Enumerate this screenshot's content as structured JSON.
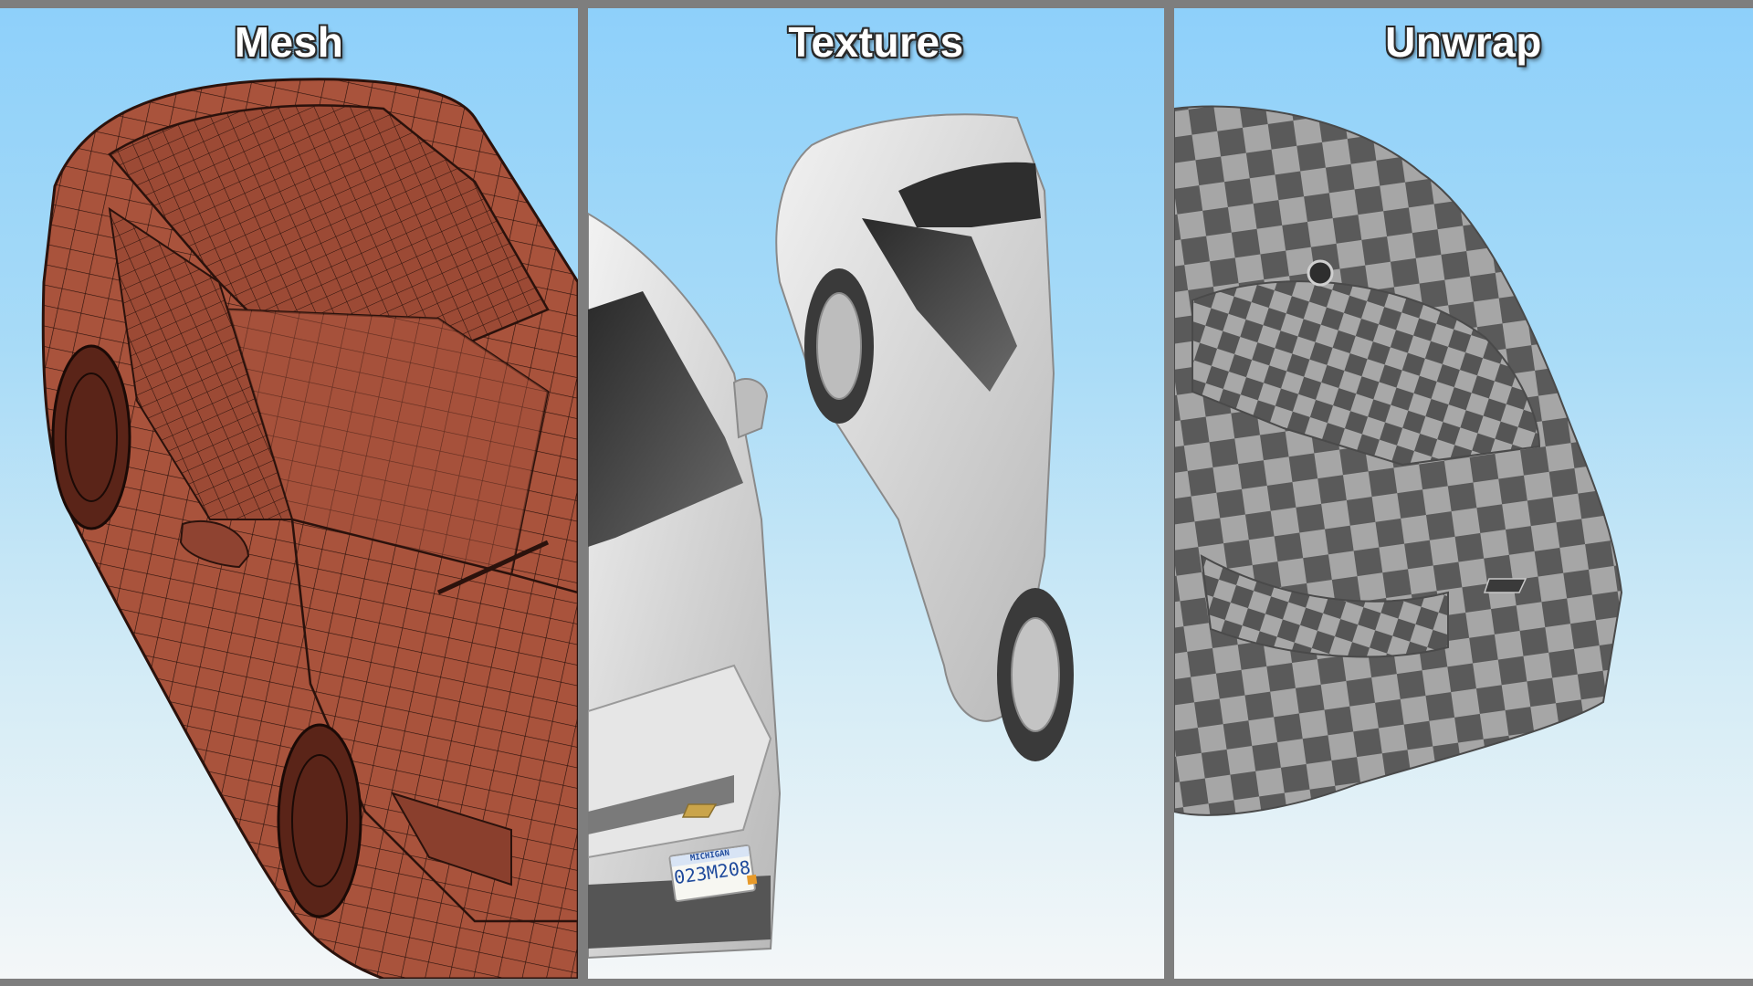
{
  "panels": {
    "mesh": {
      "title": "Mesh"
    },
    "textures": {
      "title": "Textures"
    },
    "unwrap": {
      "title": "Unwrap"
    }
  },
  "license_plate": {
    "state": "MICHIGAN",
    "number": "023M208"
  },
  "colors": {
    "frame": "#7e7e7e",
    "sky_top": "#8ed0fa",
    "sky_bottom": "#f4f7f8",
    "mesh_body": "#a8503a",
    "mesh_wire": "#2b120c",
    "texture_body": "#dcdcdc",
    "checker_dark": "#5a5a5a",
    "checker_light": "#a6a6a6"
  }
}
